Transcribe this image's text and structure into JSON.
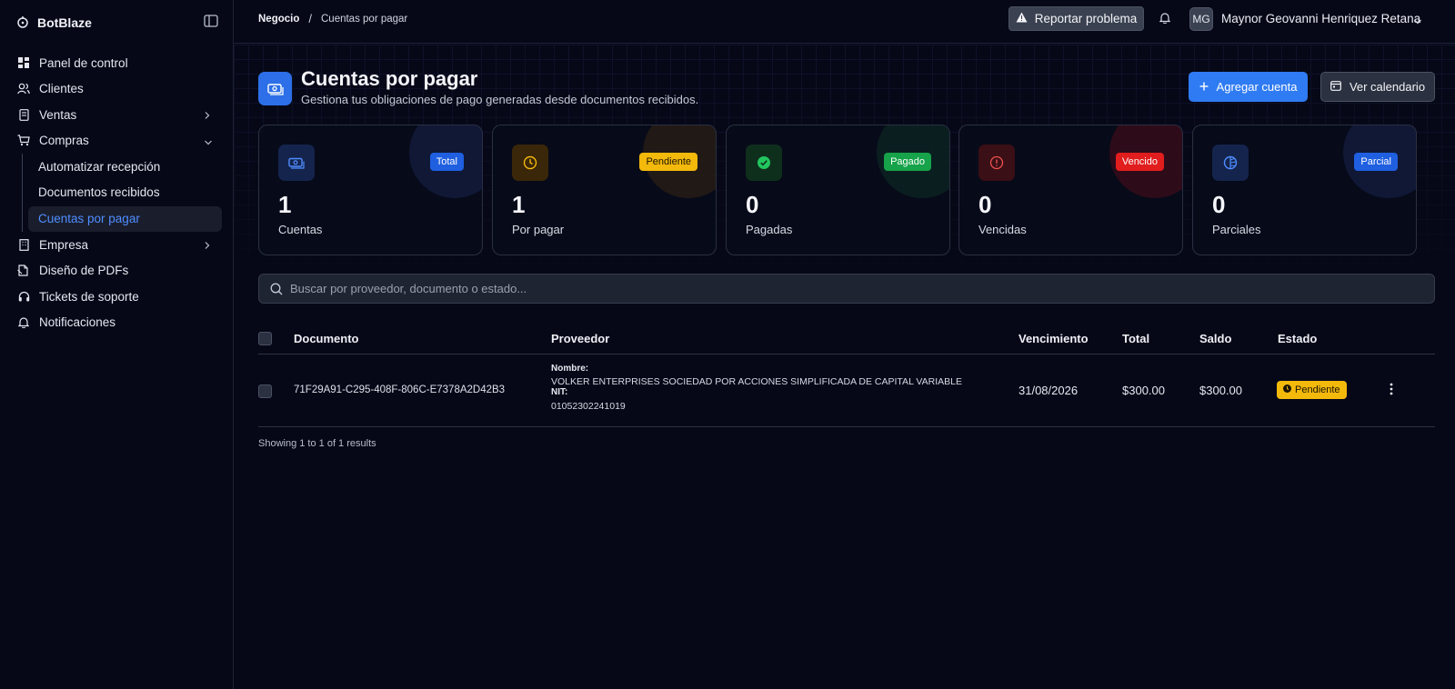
{
  "app": {
    "brand": "BotBlaze"
  },
  "sidebar": {
    "items": [
      {
        "label": "Panel de control",
        "icon": "dashboard-icon"
      },
      {
        "label": "Clientes",
        "icon": "users-icon"
      },
      {
        "label": "Ventas",
        "icon": "receipt-icon"
      },
      {
        "label": "Compras",
        "icon": "cart-icon"
      },
      {
        "label": "Empresa",
        "icon": "building-icon"
      },
      {
        "label": "Diseño de PDFs",
        "icon": "pdf-icon"
      },
      {
        "label": "Tickets de soporte",
        "icon": "headset-icon"
      },
      {
        "label": "Notificaciones",
        "icon": "bell-icon"
      }
    ],
    "compras_sub": [
      {
        "label": "Automatizar recepción"
      },
      {
        "label": "Documentos recibidos"
      },
      {
        "label": "Cuentas por pagar",
        "active": true
      }
    ]
  },
  "topbar": {
    "breadcrumb": [
      "Negocio",
      "/",
      "Cuentas por pagar"
    ],
    "report_label": "Reportar problema",
    "avatar_initials": "MG",
    "user_name": "Maynor Geovanni Henriquez Retana"
  },
  "header": {
    "title": "Cuentas por pagar",
    "subtitle": "Gestiona tus obligaciones de pago generadas desde documentos recibidos.",
    "add_label": "Agregar cuenta",
    "calendar_label": "Ver calendario"
  },
  "stats": [
    {
      "badge": "Total",
      "value": "1",
      "label": "Cuentas",
      "color": "#1f5fe0",
      "icon": "money-icon"
    },
    {
      "badge": "Pendiente",
      "value": "1",
      "label": "Por pagar",
      "color": "#f3b90b",
      "icon": "clock-icon"
    },
    {
      "badge": "Pagado",
      "value": "0",
      "label": "Pagadas",
      "color": "#16a34a",
      "icon": "check-circle-icon"
    },
    {
      "badge": "Vencido",
      "value": "0",
      "label": "Vencidas",
      "color": "#e11d1d",
      "icon": "alert-circle-icon"
    },
    {
      "badge": "Parcial",
      "value": "0",
      "label": "Parciales",
      "color": "#1f5fe0",
      "icon": "pie-icon"
    }
  ],
  "search": {
    "placeholder": "Buscar por proveedor, documento o estado..."
  },
  "table": {
    "headers": [
      "Documento",
      "Proveedor",
      "Vencimiento",
      "Total",
      "Saldo",
      "Estado"
    ],
    "rows": [
      {
        "documento": "71F29A91-C295-408F-806C-E7378A2D42B3",
        "nombre_label": "Nombre:",
        "nombre": "VOLKER ENTERPRISES SOCIEDAD POR ACCIONES SIMPLIFICADA DE CAPITAL VARIABLE",
        "nit_label": "NIT:",
        "nit": "01052302241019",
        "vencimiento": "31/08/2026",
        "total": "$300.00",
        "saldo": "$300.00",
        "estado": "Pendiente"
      }
    ]
  },
  "results_text": "Showing 1 to 1 of 1 results"
}
